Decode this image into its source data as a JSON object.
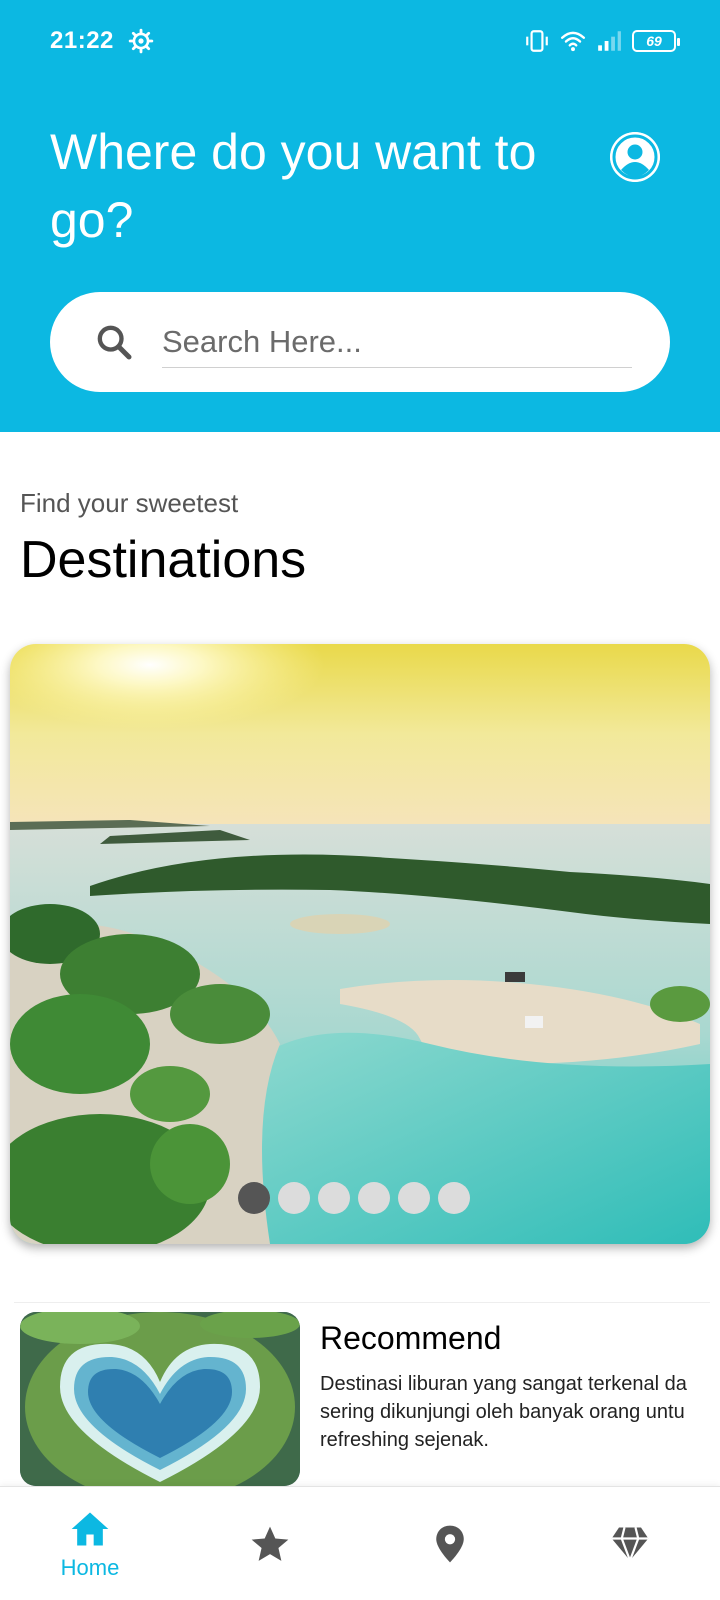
{
  "status_bar": {
    "time": "21:22",
    "battery": "69",
    "icons": [
      "gear-icon",
      "vibrate-icon",
      "wifi-icon",
      "signal-icon",
      "battery-icon"
    ]
  },
  "header": {
    "title": "Where do you want to go?",
    "avatar_icon": "user-avatar-icon",
    "color": "#0cb8e2"
  },
  "search": {
    "placeholder": "Search Here...",
    "value": "",
    "icon": "search-icon"
  },
  "main": {
    "subtitle": "Find your sweetest",
    "heading": "Destinations",
    "carousel": {
      "slide_count": 6,
      "active_index": 0,
      "image": "beach-lagoon-sunset-photo"
    },
    "recommend": {
      "title": "Recommend",
      "description": "Destinasi liburan yang sangat terkenal da\nsering dikunjungi oleh banyak orang untu\nrefreshing sejenak.",
      "image": "heart-shaped-lagoon-photo"
    }
  },
  "bottom_nav": {
    "items": [
      {
        "label": "Home",
        "icon": "home-icon",
        "active": true
      },
      {
        "label": "",
        "icon": "star-icon",
        "active": false
      },
      {
        "label": "",
        "icon": "location-pin-icon",
        "active": false
      },
      {
        "label": "",
        "icon": "diamond-icon",
        "active": false
      }
    ],
    "active_color": "#0cb8e2",
    "inactive_color": "#555555"
  }
}
